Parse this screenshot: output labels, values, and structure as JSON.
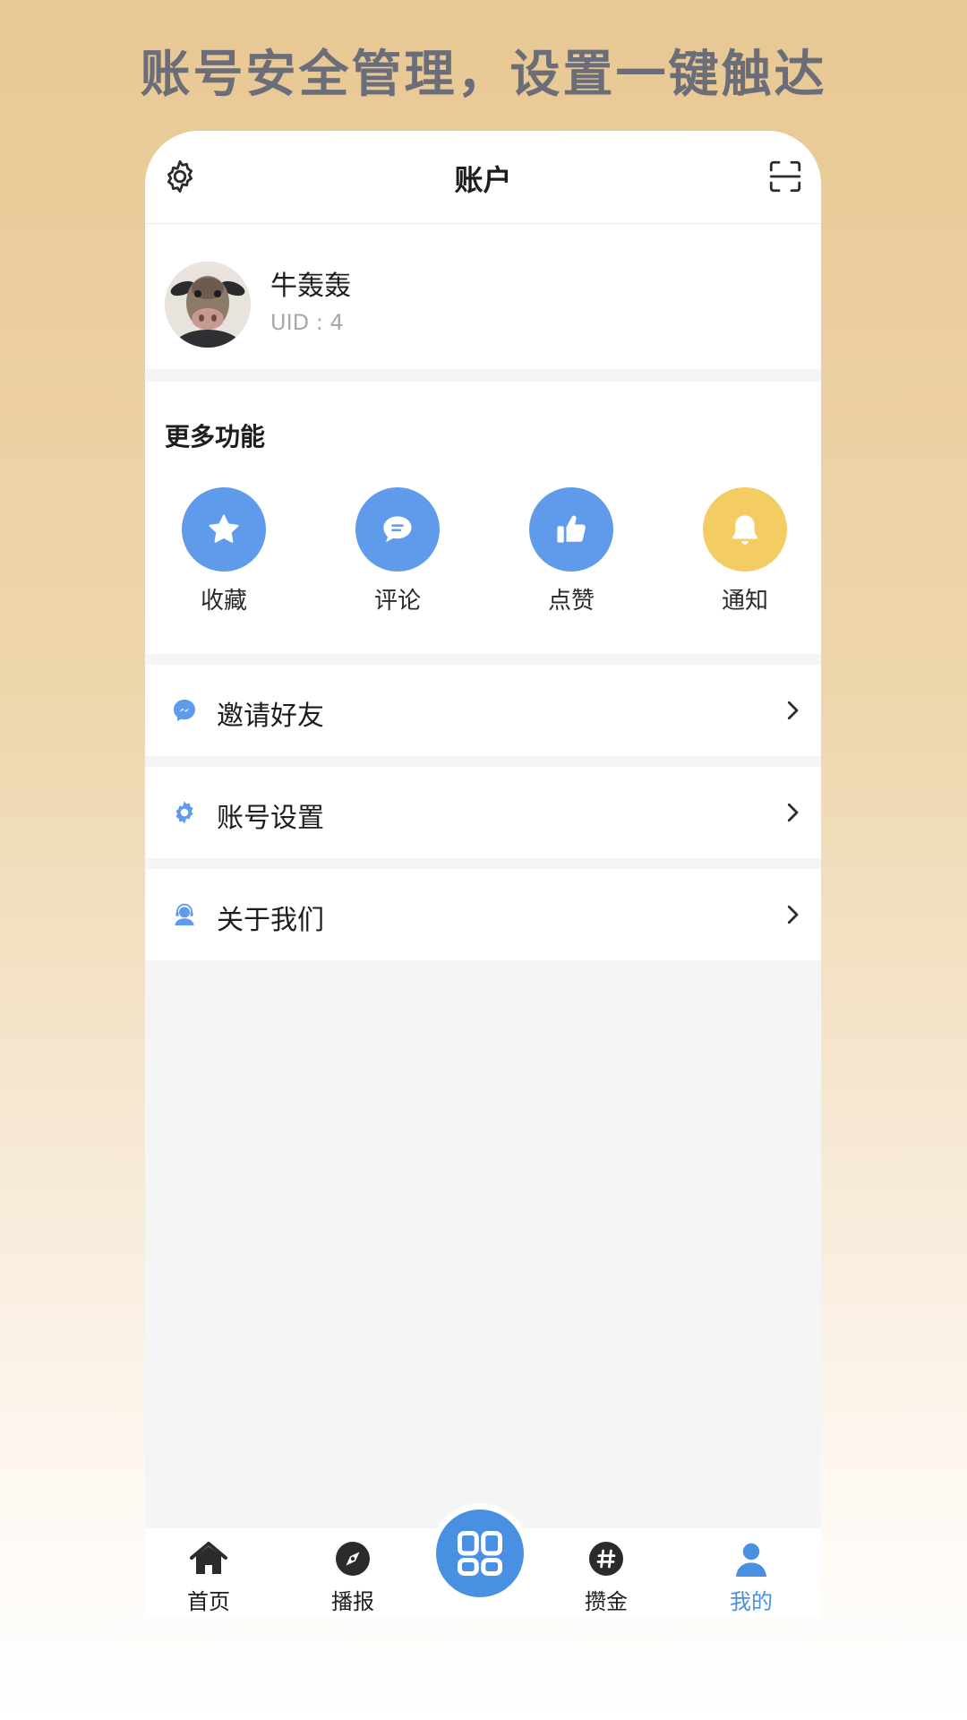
{
  "promo": {
    "title": "账号安全管理，设置一键触达"
  },
  "header": {
    "title": "账户",
    "settings_icon": "gear-icon",
    "scan_icon": "scan-icon"
  },
  "profile": {
    "name": "牛轰轰",
    "uid": "UID : 4"
  },
  "more_functions": {
    "title": "更多功能",
    "items": [
      {
        "label": "收藏",
        "icon": "star-icon",
        "color": "#5f9bea"
      },
      {
        "label": "评论",
        "icon": "comment-icon",
        "color": "#5f9bea"
      },
      {
        "label": "点赞",
        "icon": "thumbs-up-icon",
        "color": "#5f9bea"
      },
      {
        "label": "通知",
        "icon": "bell-icon",
        "color": "#f3cd64"
      }
    ]
  },
  "menu": [
    {
      "label": "邀请好友",
      "icon": "messenger-icon"
    },
    {
      "label": "账号设置",
      "icon": "gear-icon"
    },
    {
      "label": "关于我们",
      "icon": "support-agent-icon"
    }
  ],
  "tabbar": {
    "items": [
      {
        "label": "首页",
        "icon": "home-icon"
      },
      {
        "label": "播报",
        "icon": "compass-icon"
      },
      {
        "label": "攒金",
        "icon": "hashtag-icon"
      },
      {
        "label": "我的",
        "icon": "person-icon",
        "active": true
      }
    ],
    "center_icon": "apps-grid-icon"
  },
  "colors": {
    "accent": "#4a90e2",
    "notify": "#f3cd64",
    "icon_blue": "#5f9bea"
  }
}
